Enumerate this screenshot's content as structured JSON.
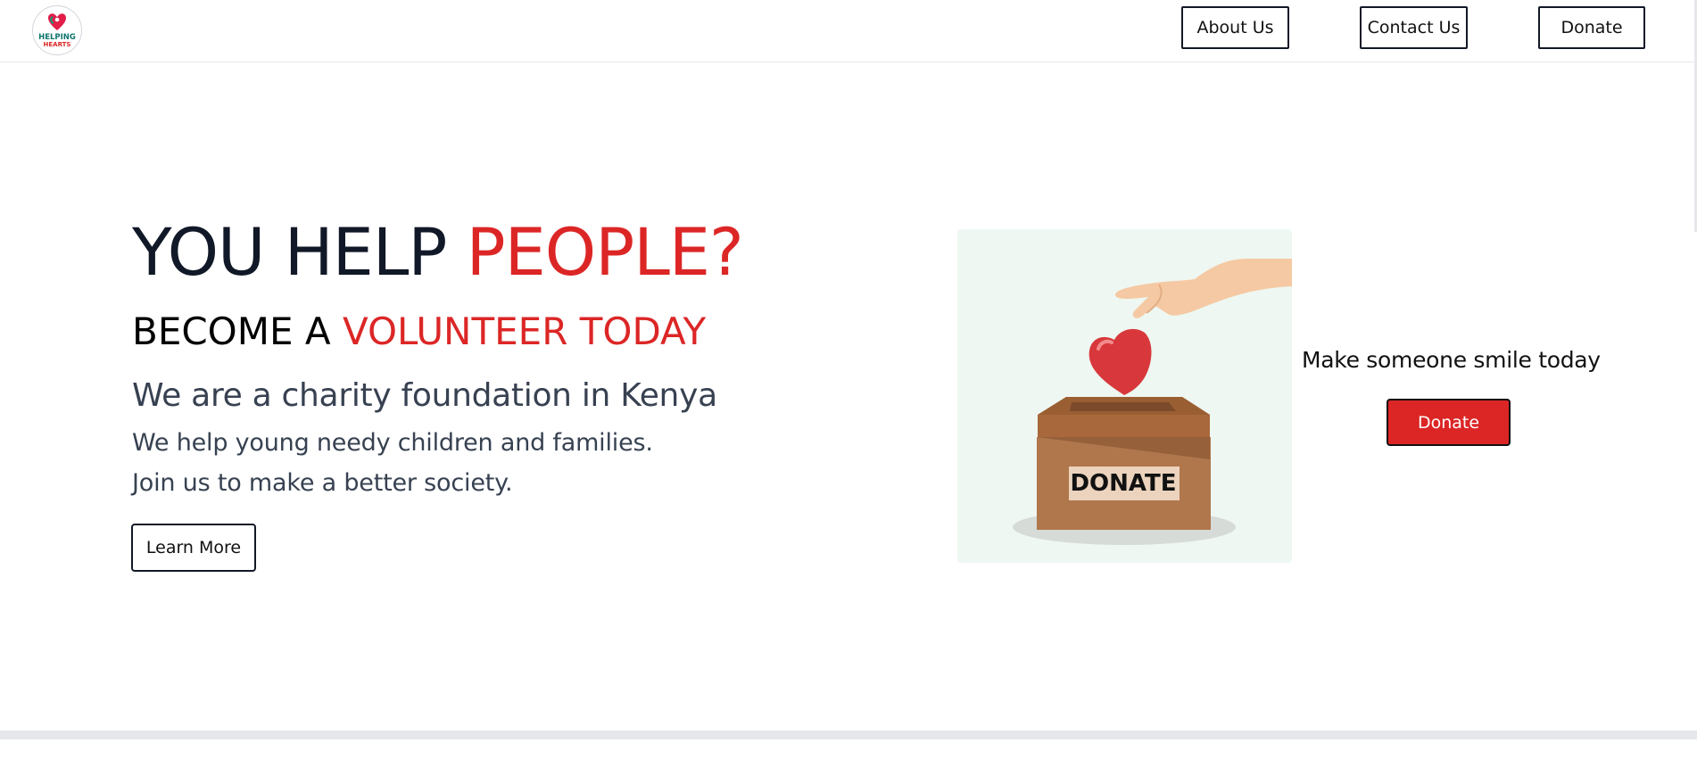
{
  "header": {
    "logo": {
      "line1": "HELPING",
      "line2": "HEARTS",
      "icon": "heart-location-pin-icon"
    },
    "nav": [
      {
        "label": "About Us"
      },
      {
        "label": "Contact Us"
      },
      {
        "label": "Donate"
      }
    ]
  },
  "hero": {
    "title_dark": "YOU HELP",
    "title_red": "PEOPLE?",
    "subtitle_dark": "BECOME A",
    "subtitle_red": "VOLUNTEER TODAY",
    "lead": "We are a charity foundation in Kenya",
    "lines": [
      "We help young needy children and families.",
      "Join us to make a better society."
    ],
    "learn_more_label": "Learn More"
  },
  "illustration": {
    "box_label": "DONATE",
    "icon": "hand-dropping-heart-into-donation-box"
  },
  "cta": {
    "text": "Make someone smile today",
    "button_label": "Donate"
  },
  "colors": {
    "accent_red": "#dc2626",
    "dark_text": "#111827",
    "body_text": "#374151",
    "illustration_bg": "#eef7f1"
  }
}
